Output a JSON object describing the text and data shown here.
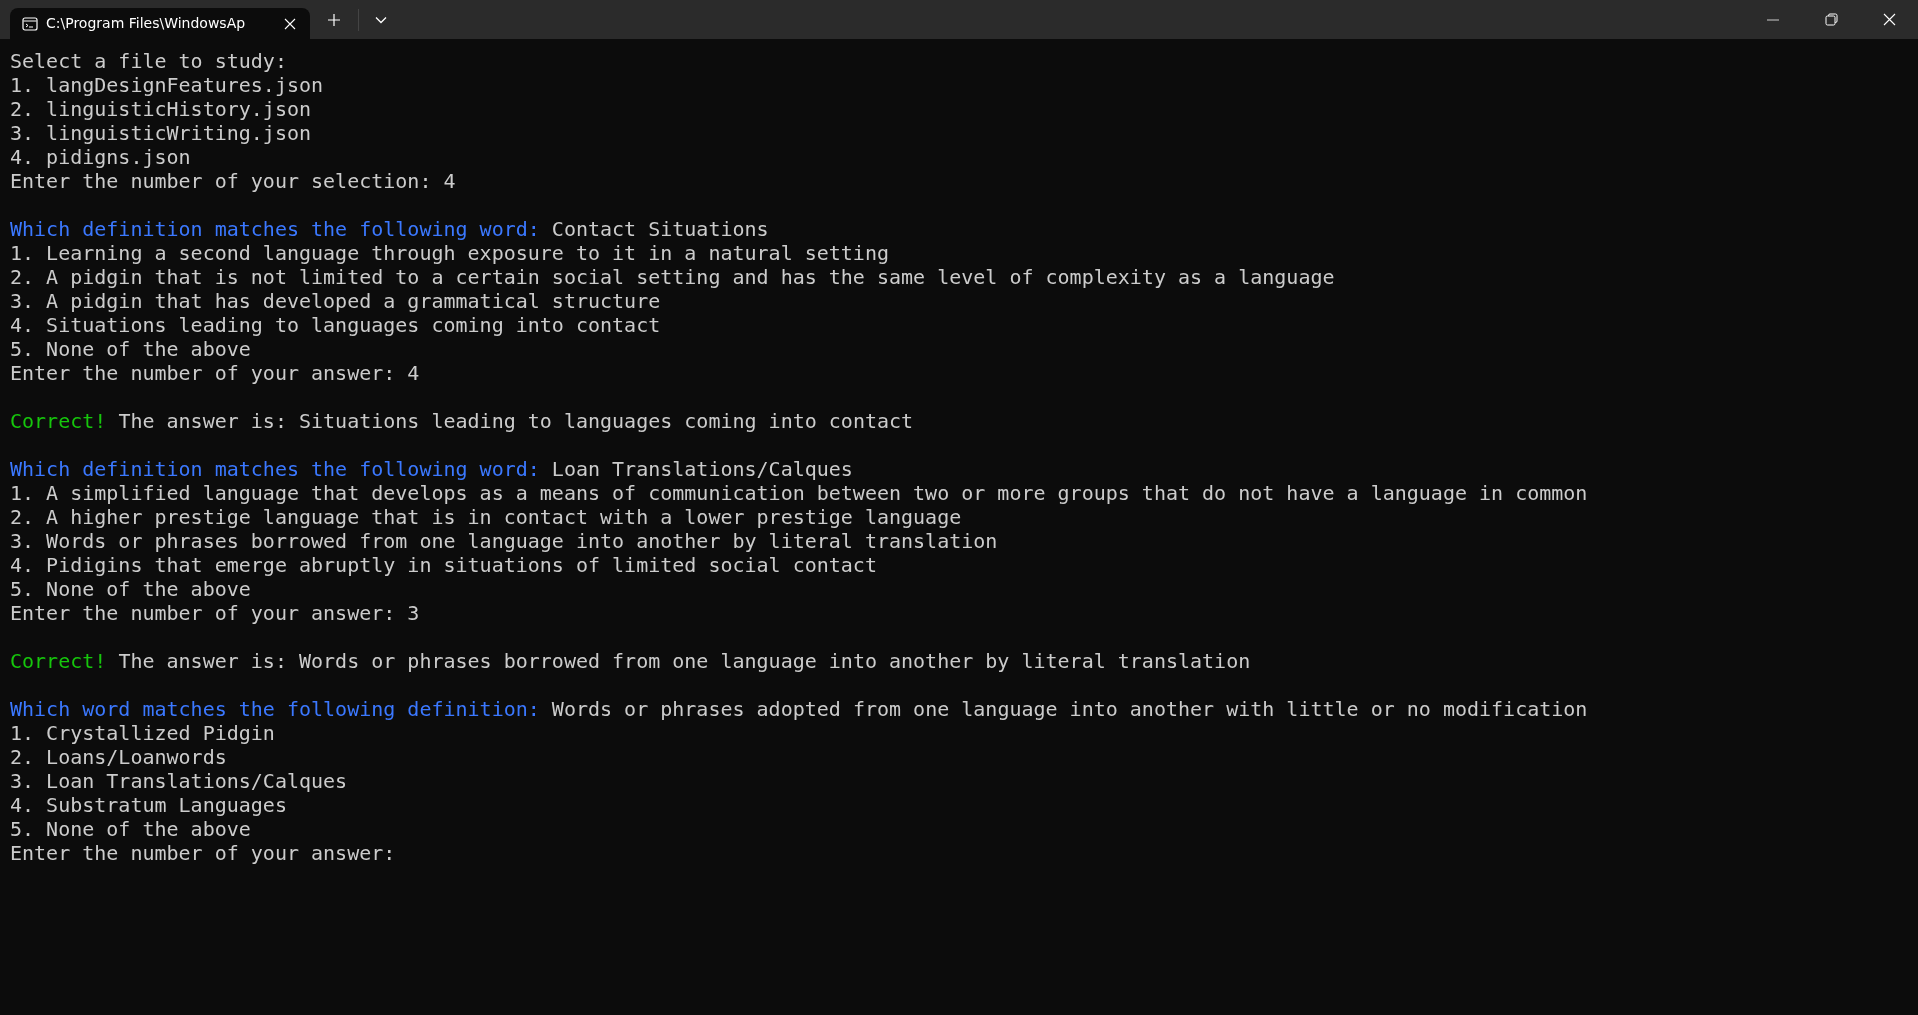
{
  "window": {
    "tab": {
      "title": "C:\\Program Files\\WindowsAp",
      "selected": true
    }
  },
  "terminal": {
    "lines": [
      {
        "kind": "text",
        "segments": [
          {
            "kind": "plain",
            "text": "Select a file to study:"
          }
        ]
      },
      {
        "kind": "text",
        "segments": [
          {
            "kind": "plain",
            "text": "1. langDesignFeatures.json"
          }
        ]
      },
      {
        "kind": "text",
        "segments": [
          {
            "kind": "plain",
            "text": "2. linguisticHistory.json"
          }
        ]
      },
      {
        "kind": "text",
        "segments": [
          {
            "kind": "plain",
            "text": "3. linguisticWriting.json"
          }
        ]
      },
      {
        "kind": "text",
        "segments": [
          {
            "kind": "plain",
            "text": "4. pidigns.json"
          }
        ]
      },
      {
        "kind": "text",
        "segments": [
          {
            "kind": "plain",
            "text": "Enter the number of your selection: 4"
          }
        ]
      },
      {
        "kind": "blank"
      },
      {
        "kind": "text",
        "segments": [
          {
            "kind": "prompt",
            "text": "Which definition matches the following word:"
          },
          {
            "kind": "plain",
            "text": "Contact Situations"
          }
        ]
      },
      {
        "kind": "text",
        "segments": [
          {
            "kind": "plain",
            "text": "1. Learning a second language through exposure to it in a natural setting"
          }
        ]
      },
      {
        "kind": "text",
        "segments": [
          {
            "kind": "plain",
            "text": "2. A pidgin that is not limited to a certain social setting and has the same level of complexity as a language"
          }
        ]
      },
      {
        "kind": "text",
        "segments": [
          {
            "kind": "plain",
            "text": "3. A pidgin that has developed a grammatical structure"
          }
        ]
      },
      {
        "kind": "text",
        "segments": [
          {
            "kind": "plain",
            "text": "4. Situations leading to languages coming into contact"
          }
        ]
      },
      {
        "kind": "text",
        "segments": [
          {
            "kind": "plain",
            "text": "5. None of the above"
          }
        ]
      },
      {
        "kind": "text",
        "segments": [
          {
            "kind": "plain",
            "text": "Enter the number of your answer: 4"
          }
        ]
      },
      {
        "kind": "blank"
      },
      {
        "kind": "text",
        "segments": [
          {
            "kind": "correct",
            "text": "Correct!"
          },
          {
            "kind": "plain",
            "text": "The answer is: Situations leading to languages coming into contact"
          }
        ]
      },
      {
        "kind": "blank"
      },
      {
        "kind": "text",
        "segments": [
          {
            "kind": "prompt",
            "text": "Which definition matches the following word:"
          },
          {
            "kind": "plain",
            "text": "Loan Translations/Calques"
          }
        ]
      },
      {
        "kind": "text",
        "segments": [
          {
            "kind": "plain",
            "text": "1. A simplified language that develops as a means of communication between two or more groups that do not have a language in common"
          }
        ]
      },
      {
        "kind": "text",
        "segments": [
          {
            "kind": "plain",
            "text": "2. A higher prestige language that is in contact with a lower prestige language"
          }
        ]
      },
      {
        "kind": "text",
        "segments": [
          {
            "kind": "plain",
            "text": "3. Words or phrases borrowed from one language into another by literal translation"
          }
        ]
      },
      {
        "kind": "text",
        "segments": [
          {
            "kind": "plain",
            "text": "4. Pidigins that emerge abruptly in situations of limited social contact"
          }
        ]
      },
      {
        "kind": "text",
        "segments": [
          {
            "kind": "plain",
            "text": "5. None of the above"
          }
        ]
      },
      {
        "kind": "text",
        "segments": [
          {
            "kind": "plain",
            "text": "Enter the number of your answer: 3"
          }
        ]
      },
      {
        "kind": "blank"
      },
      {
        "kind": "text",
        "segments": [
          {
            "kind": "correct",
            "text": "Correct!"
          },
          {
            "kind": "plain",
            "text": "The answer is: Words or phrases borrowed from one language into another by literal translation"
          }
        ]
      },
      {
        "kind": "blank"
      },
      {
        "kind": "text",
        "segments": [
          {
            "kind": "prompt",
            "text": "Which word matches the following definition:"
          },
          {
            "kind": "plain",
            "text": "Words or phrases adopted from one language into another with little or no modification"
          }
        ]
      },
      {
        "kind": "text",
        "segments": [
          {
            "kind": "plain",
            "text": "1. Crystallized Pidgin"
          }
        ]
      },
      {
        "kind": "text",
        "segments": [
          {
            "kind": "plain",
            "text": "2. Loans/Loanwords"
          }
        ]
      },
      {
        "kind": "text",
        "segments": [
          {
            "kind": "plain",
            "text": "3. Loan Translations/Calques"
          }
        ]
      },
      {
        "kind": "text",
        "segments": [
          {
            "kind": "plain",
            "text": "4. Substratum Languages"
          }
        ]
      },
      {
        "kind": "text",
        "segments": [
          {
            "kind": "plain",
            "text": "5. None of the above"
          }
        ]
      },
      {
        "kind": "text",
        "segments": [
          {
            "kind": "plain",
            "text": "Enter the number of your answer:"
          }
        ]
      }
    ]
  }
}
